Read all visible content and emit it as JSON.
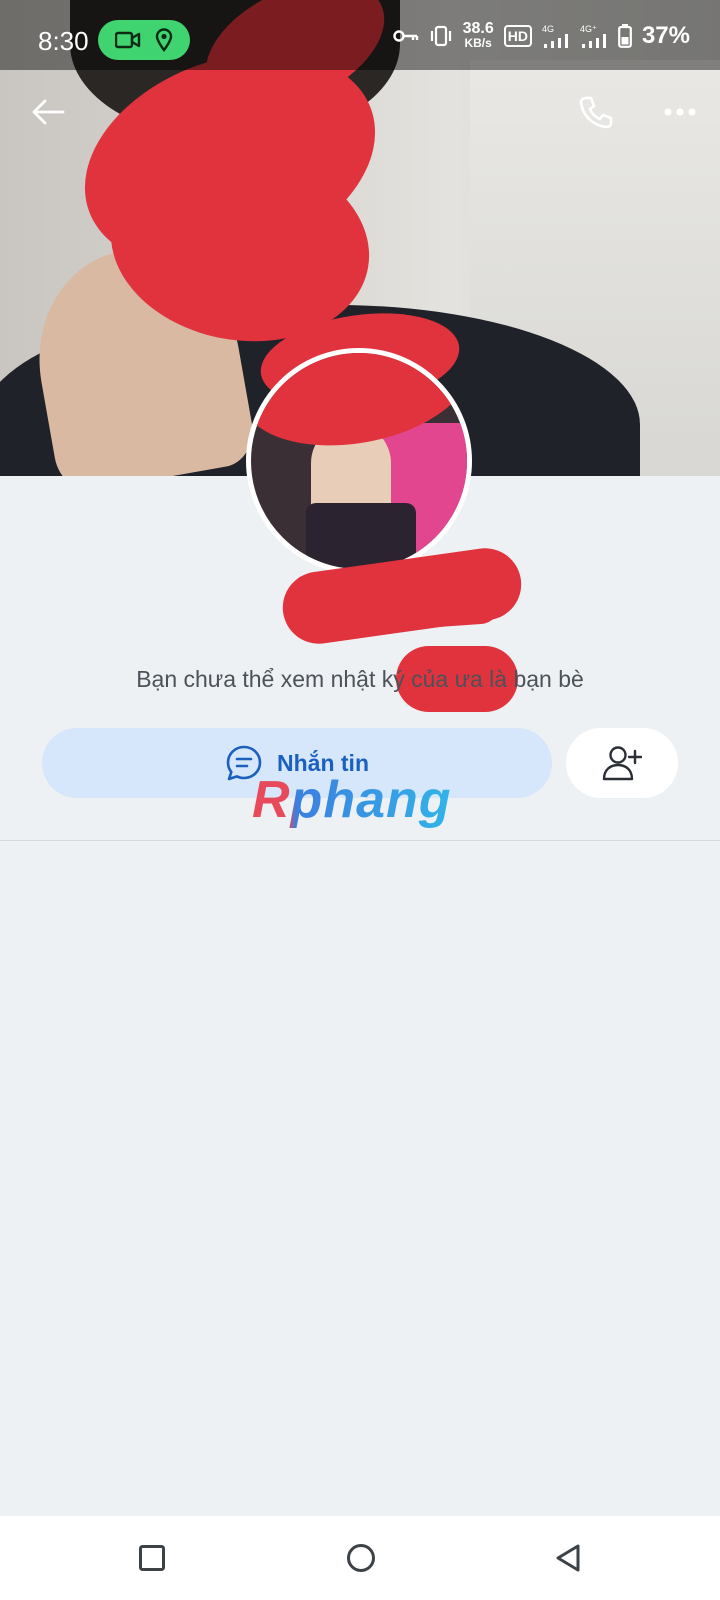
{
  "status_bar": {
    "time": "8:30",
    "speed_value": "38.6",
    "speed_unit": "KB/s",
    "hd_label": "HD",
    "net1": "4G",
    "net2": "4G⁺",
    "battery": "37%",
    "pill_color": "#3fd470"
  },
  "app_bar": {
    "back_icon": "back-arrow-icon",
    "call_icon": "phone-icon",
    "more_icon": "more-dots-icon"
  },
  "profile": {
    "private_note": "Bạn chưa thể xem nhật ký của                      ưa là bạn bè"
  },
  "actions": {
    "message_label": "Nhắn tin",
    "message_icon": "chat-bubble-icon",
    "add_friend_icon": "add-friend-icon",
    "accent_color": "#1b5fbf"
  },
  "watermark": {
    "text": "Rphang"
  },
  "nav_bar": {
    "recents_icon": "square-icon",
    "home_icon": "circle-icon",
    "back_icon": "triangle-back-icon"
  }
}
